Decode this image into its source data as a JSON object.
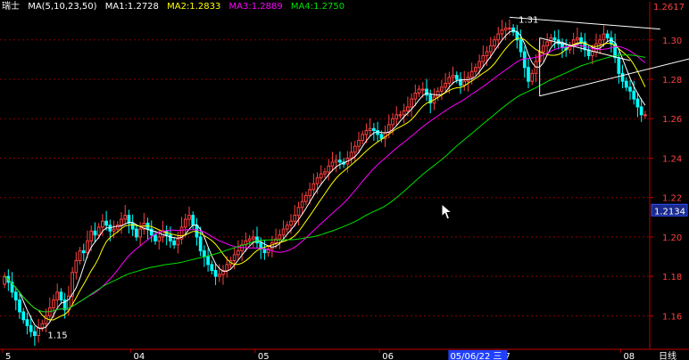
{
  "header": {
    "symbol": "瑞士",
    "indicator": "MA(5,10,23,50)",
    "ma1": "MA1:1.2728",
    "ma2": "MA2:1.2833",
    "ma3": "MA3:1.2889",
    "ma4": "MA4:1.2750"
  },
  "colors": {
    "background": "#000000",
    "grid": "#8b0000",
    "axis": "#c00000",
    "up": "#ff4040",
    "down": "#00ffff",
    "ma1": "#ffffff",
    "ma2": "#ffff00",
    "ma3": "#ff00ff",
    "ma4": "#00e000",
    "label": "#ff4040",
    "date_highlight": "#2040ff"
  },
  "chart_data": {
    "type": "candlestick",
    "ylim": [
      1.143,
      1.313
    ],
    "y_ticks": [
      {
        "value": 1.3,
        "label": "1.30"
      },
      {
        "value": 1.28,
        "label": "1.28"
      },
      {
        "value": 1.26,
        "label": "1.26"
      },
      {
        "value": 1.24,
        "label": "1.24"
      },
      {
        "value": 1.22,
        "label": "1.22"
      },
      {
        "value": 1.2,
        "label": "1.20"
      },
      {
        "value": 1.18,
        "label": "1.18"
      },
      {
        "value": 1.16,
        "label": "1.16"
      }
    ],
    "x_labels": [
      {
        "index": 0,
        "label": "5"
      },
      {
        "index": 34,
        "label": "04"
      },
      {
        "index": 67,
        "label": "05"
      },
      {
        "index": 100,
        "label": "06"
      },
      {
        "index": 131,
        "label": "07"
      },
      {
        "index": 164,
        "label": "08"
      }
    ],
    "date_readout": {
      "index": 123,
      "label": "05/06/22 三"
    },
    "timeframe_label": "日线",
    "last_price": {
      "value": 1.2617,
      "label": "1.2617"
    },
    "cursor_price": {
      "value": 1.2134,
      "label": "1.2134"
    },
    "annotations": [
      {
        "index": 10,
        "value": 1.15,
        "label": "1.15"
      },
      {
        "index": 135,
        "value": 1.31,
        "label": "1.31"
      }
    ],
    "trend_lines": [
      {
        "from": [
          134,
          1.3115
        ],
        "to": [
          174,
          1.3055
        ]
      },
      {
        "from": [
          142,
          1.2715
        ],
        "to": [
          182,
          1.2905
        ]
      },
      {
        "from": [
          142,
          1.2715
        ],
        "to": [
          142,
          1.301
        ]
      },
      {
        "from": [
          142,
          1.301
        ],
        "to": [
          166,
          1.2895
        ]
      }
    ],
    "close": [
      1.18,
      1.177,
      1.172,
      1.168,
      1.162,
      1.158,
      1.155,
      1.152,
      1.15,
      1.154,
      1.156,
      1.16,
      1.164,
      1.168,
      1.172,
      1.168,
      1.163,
      1.17,
      1.182,
      1.188,
      1.193,
      1.192,
      1.198,
      1.203,
      1.201,
      1.205,
      1.208,
      1.206,
      1.203,
      1.204,
      1.206,
      1.209,
      1.211,
      1.207,
      1.204,
      1.2,
      1.204,
      1.207,
      1.204,
      1.201,
      1.198,
      1.2,
      1.203,
      1.201,
      1.198,
      1.196,
      1.199,
      1.205,
      1.209,
      1.211,
      1.206,
      1.2,
      1.193,
      1.19,
      1.186,
      1.183,
      1.18,
      1.181,
      1.183,
      1.186,
      1.188,
      1.191,
      1.193,
      1.196,
      1.198,
      1.199,
      1.2,
      1.197,
      1.194,
      1.192,
      1.194,
      1.197,
      1.199,
      1.201,
      1.204,
      1.206,
      1.208,
      1.211,
      1.215,
      1.218,
      1.221,
      1.224,
      1.227,
      1.23,
      1.232,
      1.233,
      1.236,
      1.238,
      1.239,
      1.238,
      1.237,
      1.24,
      1.243,
      1.246,
      1.249,
      1.252,
      1.254,
      1.255,
      1.254,
      1.252,
      1.25,
      1.253,
      1.257,
      1.26,
      1.262,
      1.262,
      1.264,
      1.266,
      1.27,
      1.273,
      1.275,
      1.275,
      1.272,
      1.268,
      1.271,
      1.274,
      1.276,
      1.278,
      1.281,
      1.282,
      1.28,
      1.277,
      1.279,
      1.281,
      1.284,
      1.286,
      1.289,
      1.292,
      1.294,
      1.297,
      1.3,
      1.303,
      1.305,
      1.306,
      1.306,
      1.304,
      1.3,
      1.294,
      1.286,
      1.279,
      1.283,
      1.289,
      1.294,
      1.297,
      1.299,
      1.301,
      1.3,
      1.298,
      1.296,
      1.295,
      1.297,
      1.3,
      1.301,
      1.299,
      1.295,
      1.292,
      1.294,
      1.298,
      1.3,
      1.303,
      1.301,
      1.298,
      1.291,
      1.283,
      1.279,
      1.276,
      1.274,
      1.27,
      1.266,
      1.262,
      1.262
    ]
  }
}
